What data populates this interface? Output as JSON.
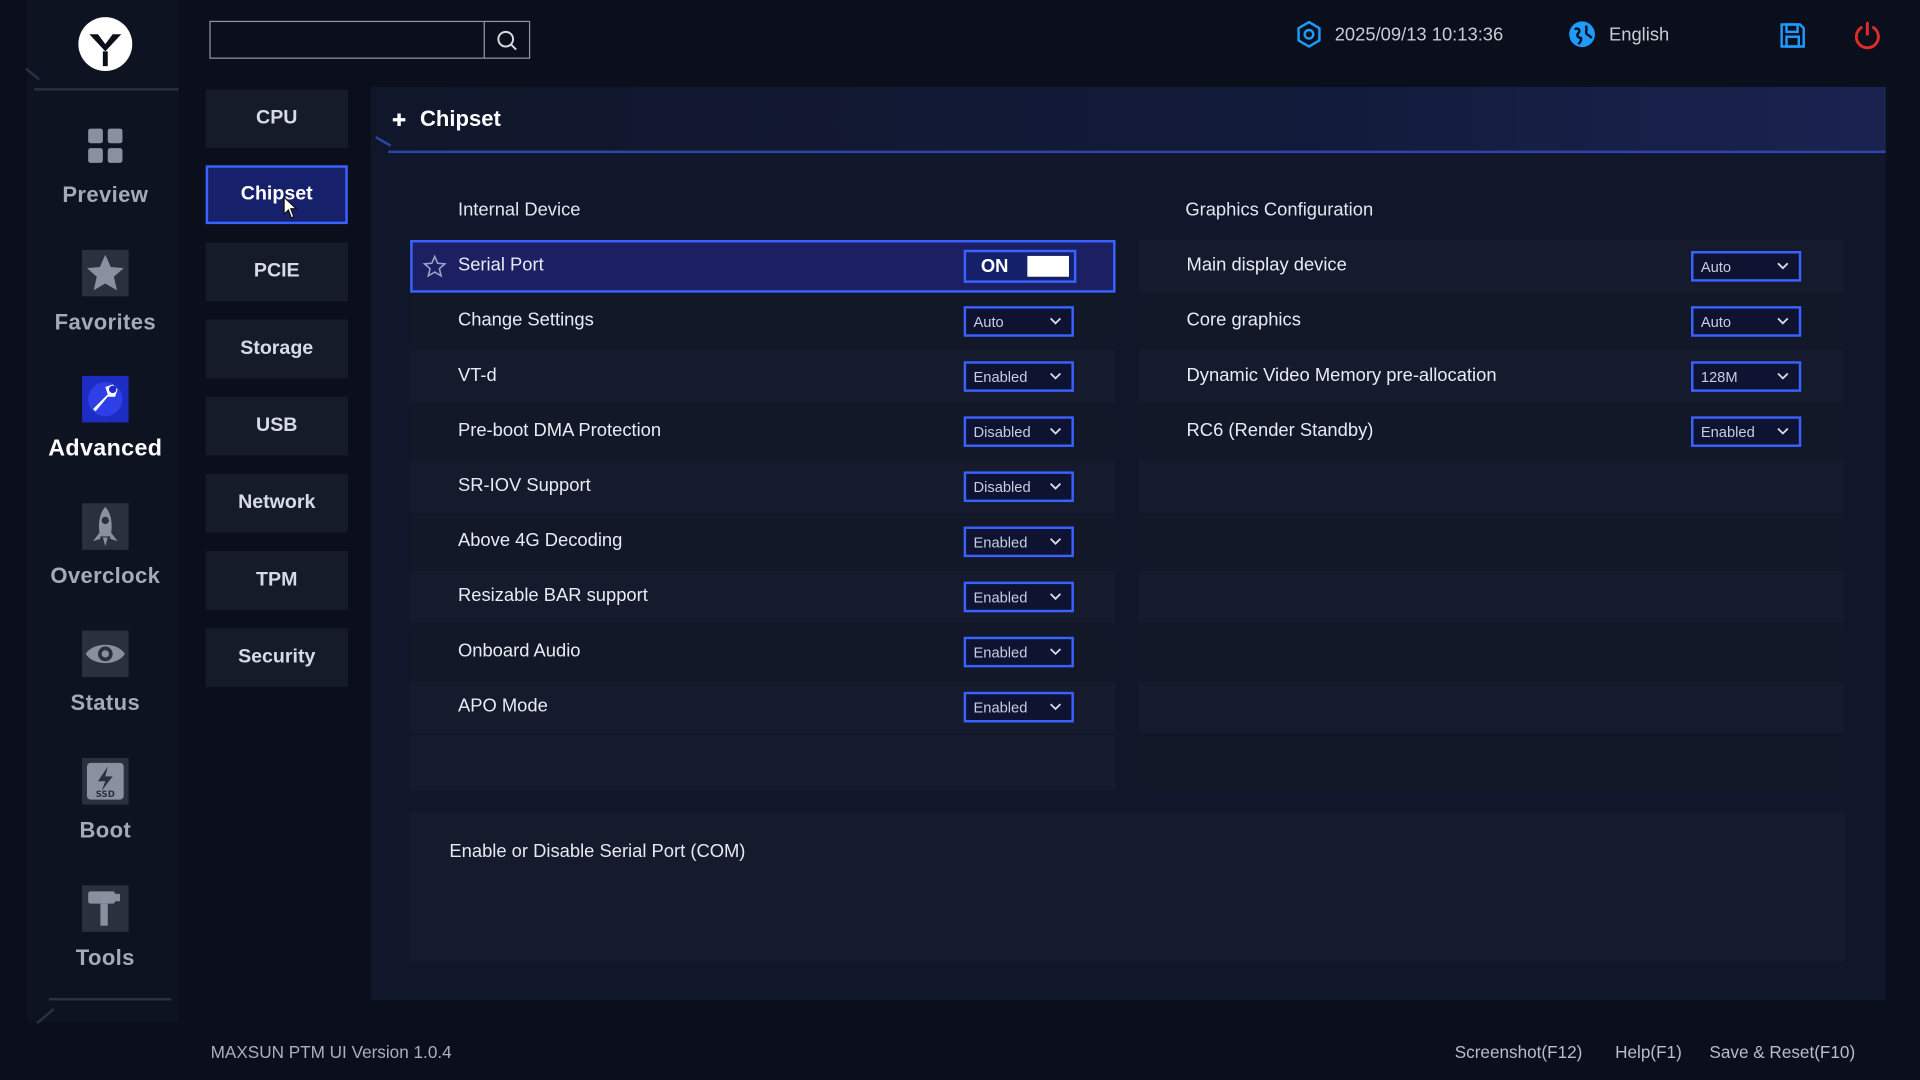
{
  "header": {
    "search": {
      "value": "",
      "placeholder": ""
    },
    "datetime": "2025/09/13 10:13:36",
    "language": "English"
  },
  "nav": [
    {
      "label": "Preview",
      "icon": "grid-icon"
    },
    {
      "label": "Favorites",
      "icon": "star-icon"
    },
    {
      "label": "Advanced",
      "icon": "wrench-icon",
      "active": true
    },
    {
      "label": "Overclock",
      "icon": "rocket-icon"
    },
    {
      "label": "Status",
      "icon": "eye-icon"
    },
    {
      "label": "Boot",
      "icon": "ssd-icon"
    },
    {
      "label": "Tools",
      "icon": "hammer-icon"
    }
  ],
  "submenu": [
    "CPU",
    "Chipset",
    "PCIE",
    "Storage",
    "USB",
    "Network",
    "TPM",
    "Security"
  ],
  "active_submenu": "Chipset",
  "panel": {
    "title": "Chipset",
    "left_section": "Internal Device",
    "right_section": "Graphics Configuration",
    "left_rows": [
      {
        "label": "Serial Port",
        "value": "ON",
        "type": "toggle"
      },
      {
        "label": "Change Settings",
        "value": "Auto"
      },
      {
        "label": "VT-d",
        "value": "Enabled"
      },
      {
        "label": "Pre-boot DMA Protection",
        "value": "Disabled"
      },
      {
        "label": "SR-IOV Support",
        "value": "Disabled"
      },
      {
        "label": "Above 4G Decoding",
        "value": "Enabled"
      },
      {
        "label": "Resizable BAR support",
        "value": "Enabled"
      },
      {
        "label": "Onboard Audio",
        "value": "Enabled"
      },
      {
        "label": "APO Mode",
        "value": "Enabled"
      }
    ],
    "right_rows": [
      {
        "label": "Main display device",
        "value": "Auto"
      },
      {
        "label": "Core graphics",
        "value": "Auto"
      },
      {
        "label": "Dynamic Video Memory pre-allocation",
        "value": "128M"
      },
      {
        "label": "RC6 (Render Standby)",
        "value": "Enabled"
      }
    ],
    "help_text": "Enable or Disable Serial Port (COM)"
  },
  "footer": {
    "version": "MAXSUN PTM UI Version 1.0.4",
    "screenshot": "Screenshot(F12)",
    "help": "Help(F1)",
    "save_reset": "Save & Reset(F10)"
  },
  "colors": {
    "accent": "#3a62ff",
    "selected_bg": "#1d1f63",
    "power": "#e02b2b",
    "info_icon": "#1e9bff"
  }
}
